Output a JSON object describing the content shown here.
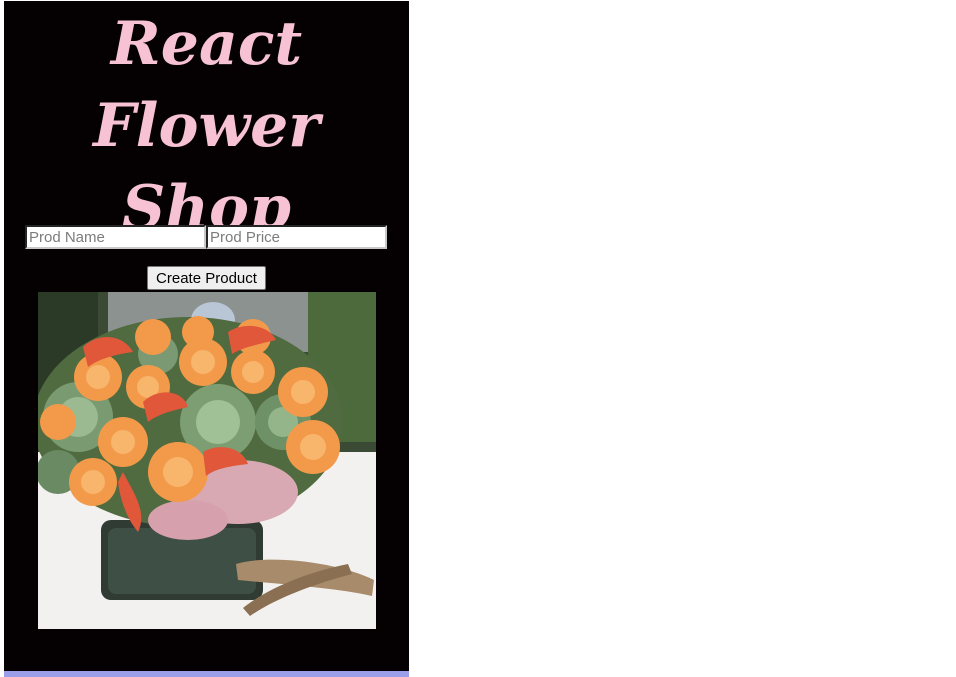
{
  "header": {
    "title": "React Flower Shop"
  },
  "form": {
    "name_placeholder": "Prod Name",
    "price_placeholder": "Prod Price",
    "name_value": "",
    "price_value": ""
  },
  "actions": {
    "create_label": "Create Product"
  },
  "product": {
    "image_description_icon": "flower-arrangement-image"
  },
  "colors": {
    "page_background": "#050103",
    "title_pink": "#f7c2d3",
    "bottom_bar": "#9b9fe9"
  }
}
